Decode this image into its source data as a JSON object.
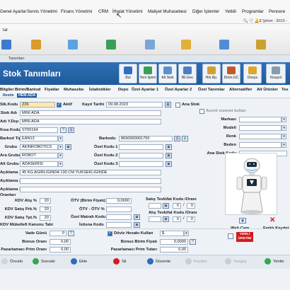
{
  "menu": {
    "items": [
      "Genel Ayarlar",
      "Servis Yönetimi",
      "Finans Yönetimi",
      "CRM",
      "İthalat Yönetimi",
      "Maliyet Muhasebesi",
      "Diğer İşlemler",
      "Yetkili",
      "Programlar",
      "Pencere"
    ],
    "system_line": "Şirket : 2023 - ",
    "notif_count": "2"
  },
  "main": {
    "title": "lar"
  },
  "window": {
    "caption": "Tanımları",
    "title": "Stok Tanımları"
  },
  "toolbar": {
    "buttons": [
      "Bul",
      "Yeni İşlem",
      "Alt Stok",
      "Bil.Gnc",
      "Hrk.Rp.",
      "Dmm.GC",
      "Dosya",
      "Kisayol"
    ]
  },
  "tabs": {
    "row1": [
      "Bilgiler",
      "Birim/Barkod",
      "Fiyatlar",
      "Muhasebe",
      "İstatistikler",
      "Depo",
      "Özel Ayarlar 1",
      "Özel Ayarlar 2",
      "Özel Tanımlar",
      "Alternatifler",
      "Alt Ürünler",
      "Tes"
    ],
    "row2": [
      "Resim",
      "HEM.ADA"
    ]
  },
  "form": {
    "stok_kodu_label": "Stk.Kodu",
    "stok_kodu": "Z26",
    "aktif_label": "Aktif",
    "kayit_tarihi_label": "Kayıt Tarihi",
    "kayit_tarihi": "09.08.2023",
    "ana_stok_label": "Ana Stok",
    "asorti_label": "Asorti sistemi kullan",
    "stok_adi_label": "Stok Adı",
    "stok_adi": "MINI ADA",
    "adi_ydisi_label": "Adı Y.Dışı",
    "adi_ydisi": "MINI ADA",
    "kisa_kodu_label": "Kısa Kodu",
    "kisa_kodu": "ST00164",
    "barkod_tipi_label": "Barkod Tipi",
    "barkod_tipi": "EAN13",
    "barkodu_label": "Barkodu",
    "barkodu": "8690000001750",
    "grubu_label": "Grubu",
    "grubu": "AKINROBOTICS",
    "ara_grubu_label": "Ara Grubu",
    "ara_grubu": "ROBOT",
    "alt_grubu_label": "Alt Grubu",
    "alt_grubu": "ADASERISI",
    "ozel_kodu_1_label": "Özel Kodu 1",
    "ozel_kodu_2_label": "Özel Kodu 2",
    "ozel_kodu_3_label": "Özel Kodu 3",
    "aciklama_1_label": "Açıklama 1",
    "aciklama_1": "45 KG AĞIRLIĞINDA 130 CM YÜKSEKLİĞİNDE",
    "aciklama_2_label": "Açıklama 2",
    "aciklama_3_label": "Açıklama 3",
    "oranlar_label": "Oranları",
    "marka_label": "Markası",
    "modeli_label": "Modeli",
    "renk_label": "Renk",
    "beden_label": "Beden",
    "ana_stok_kodu_label": "Ana Stok Kodu",
    "kdv_alis_label": "KDV Alış %",
    "kdv_alis": "20",
    "kdv_satis_label": "KDV Satış Prk.%",
    "kdv_satis": "20",
    "kdv_satis_tpt_label": "KDV Satış Tpt.%",
    "kdv_satis_tpt": "20",
    "kdv_kanunu_label": "KDV Mükellefi Kanunu Tabi",
    "otv_birim_label": "ÖTV (Birim Fiyatı)",
    "otv_birim": "0,0000",
    "otv_oran_label": "ÖTV - ÖTV %",
    "ozel_matrah_label": "Özel Matrah Kodu",
    "istisna_label": "İstisna Kodu",
    "satis_tevkifat_label": "Satış Tevkifat Kodu /Oranı",
    "alis_tevkifat_label": "Alış Tevkifat Kodu /Oranı",
    "tevkifat_a": "0",
    "tevkifat_b": "0",
    "tevkifat_c": "0",
    "tevkifat_d": "0",
    "vade_gunu_label": "Vade Günü",
    "vade_gunu": "0",
    "bonus_orani_label": "Bonus Oranı",
    "bonus_orani": "0,00",
    "pazarlamaci_label": "Pazarlamacı Prim Oranı",
    "pazarlamaci": "0,00",
    "doviz_label": "Döviz Hesabı Kullan",
    "doviz": "$",
    "bonus_birim_label": "Bonus Birim Fiyatı",
    "bonus_birim": "0,0000",
    "pazarlamaci_tutar_label": "Pazarlamacı Prim Tutarı",
    "pazarlamaci_tutar": "0,00",
    "web_cam_label": "Web Cam",
    "farkli_kaydet_label": "Farklı Kaydet",
    "yerli_uretim_label": "YERLİ ÜRETİM"
  },
  "bottom": {
    "buttons": [
      "Önceki",
      "Sonraki",
      "Ekle",
      "Sil",
      "Düzenle",
      "Kaydet",
      "Vazgeç",
      "Yenile"
    ]
  },
  "colors": {
    "banner": "#1e5a9c",
    "accent": "#2d6bc0",
    "green": "#2fa84f",
    "red": "#d21c1c"
  }
}
